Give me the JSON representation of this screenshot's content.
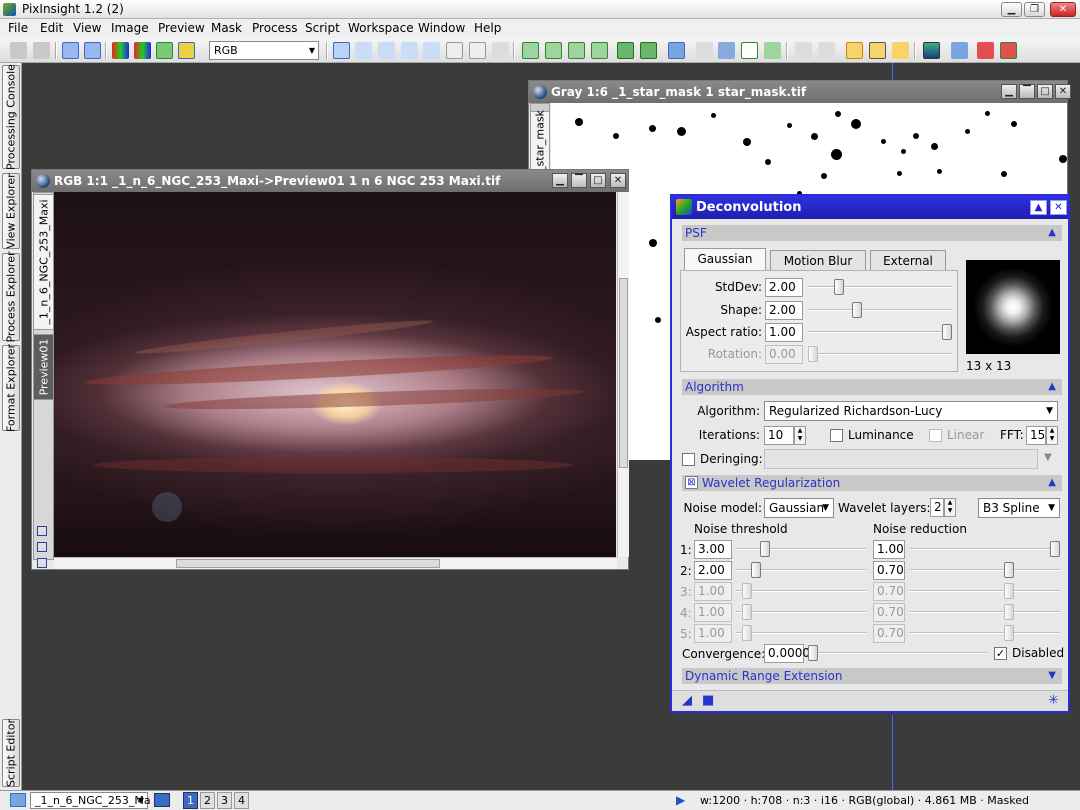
{
  "app": {
    "title": "PixInsight 1.2 (2)"
  },
  "menu": [
    "File",
    "Edit",
    "View",
    "Image",
    "Preview",
    "Mask",
    "Process",
    "Script",
    "Workspace",
    "Window",
    "Help"
  ],
  "toolbar": {
    "color_mode": "RGB"
  },
  "dock_tabs": {
    "processing_console": "Processing Console",
    "view_explorer": "View Explorer",
    "process_explorer": "Process Explorer",
    "format_explorer": "Format Explorer",
    "script_editor": "Script Editor"
  },
  "gray_window": {
    "title": "Gray 1:6 _1_star_mask 1 star_mask.tif",
    "side_tab": "_star_mask"
  },
  "rgb_window": {
    "title": "RGB 1:1 _1_n_6_NGC_253_Maxi->Preview01 1 n 6 NGC 253 Maxi.tif",
    "side_tab_main": "_1_n_6_NGC_253_Maxi",
    "side_tab_preview": "Preview01"
  },
  "deconvolution": {
    "title": "Deconvolution",
    "psf_section": "PSF",
    "psf_tabs": [
      "Gaussian PSF",
      "Motion Blur PSF",
      "External PSF"
    ],
    "stddev_label": "StdDev:",
    "stddev": "2.00",
    "shape_label": "Shape:",
    "shape": "2.00",
    "aspect_label": "Aspect ratio:",
    "aspect": "1.00",
    "rotation_label": "Rotation:",
    "rotation": "0.00",
    "psf_size": "13 x 13",
    "algorithm_section": "Algorithm",
    "algorithm_label": "Algorithm:",
    "algorithm": "Regularized Richardson-Lucy",
    "iterations_label": "Iterations:",
    "iterations": "10",
    "luminance_label": "Luminance",
    "linear_label": "Linear",
    "fft_label": "FFT:",
    "fft": "15",
    "deringing_label": "Deringing:",
    "wavelet_section": "Wavelet Regularization",
    "noise_model_label": "Noise model:",
    "noise_model": "Gaussian",
    "wavelet_layers_label": "Wavelet layers:",
    "wavelet_layers": "2",
    "scaling_function": "B3 Spline",
    "noise_threshold_label": "Noise threshold",
    "noise_reduction_label": "Noise reduction",
    "layers": [
      {
        "n": "1:",
        "threshold": "3.00",
        "reduction": "1.00",
        "enabled": true
      },
      {
        "n": "2:",
        "threshold": "2.00",
        "reduction": "0.70",
        "enabled": true
      },
      {
        "n": "3:",
        "threshold": "1.00",
        "reduction": "0.70",
        "enabled": false
      },
      {
        "n": "4:",
        "threshold": "1.00",
        "reduction": "0.70",
        "enabled": false
      },
      {
        "n": "5:",
        "threshold": "1.00",
        "reduction": "0.70",
        "enabled": false
      }
    ],
    "convergence_label": "Convergence:",
    "convergence": "0.0000",
    "disabled_label": "Disabled",
    "dre_section": "Dynamic Range Extension"
  },
  "statusbar": {
    "view_name": "_1_n_6_NGC_253_Ma",
    "pages": [
      "1",
      "2",
      "3",
      "4"
    ],
    "info": "w:1200 · h:708 · n:3 · i16 · RGB(global) · 4.861 MB · Masked"
  }
}
